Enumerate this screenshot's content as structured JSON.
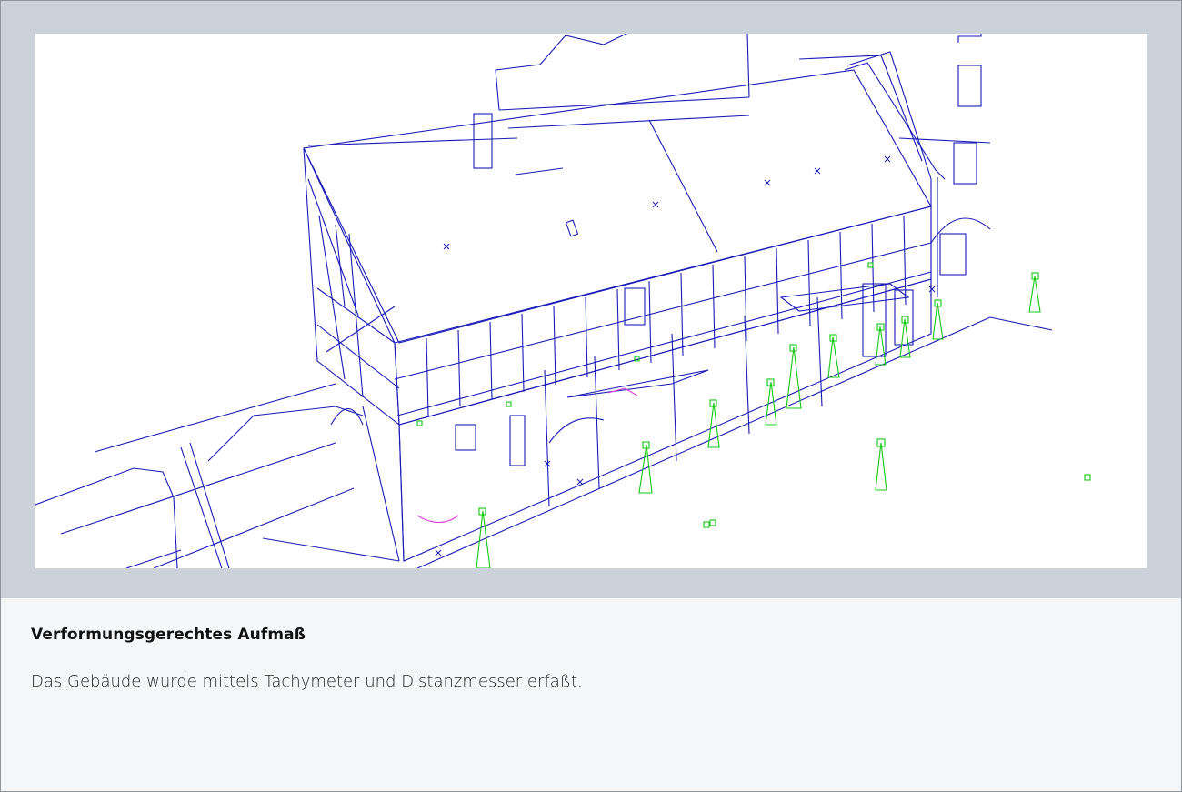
{
  "figure": {
    "title": "Verformungsgerechtes Aufmaß",
    "description": "Das Gebäude wurde mittels Tachymeter und Distanzmesser erfaßt."
  },
  "colors": {
    "frame": "#ccd2da",
    "caption_background": "#f5f6f7",
    "wireframe_line": "#1a1ab8",
    "survey_marker": "#14c814",
    "highlight": "#e040e0"
  },
  "icons": {
    "survey_marker": "tripod-marker-icon",
    "survey_point": "cross-mark-icon"
  }
}
